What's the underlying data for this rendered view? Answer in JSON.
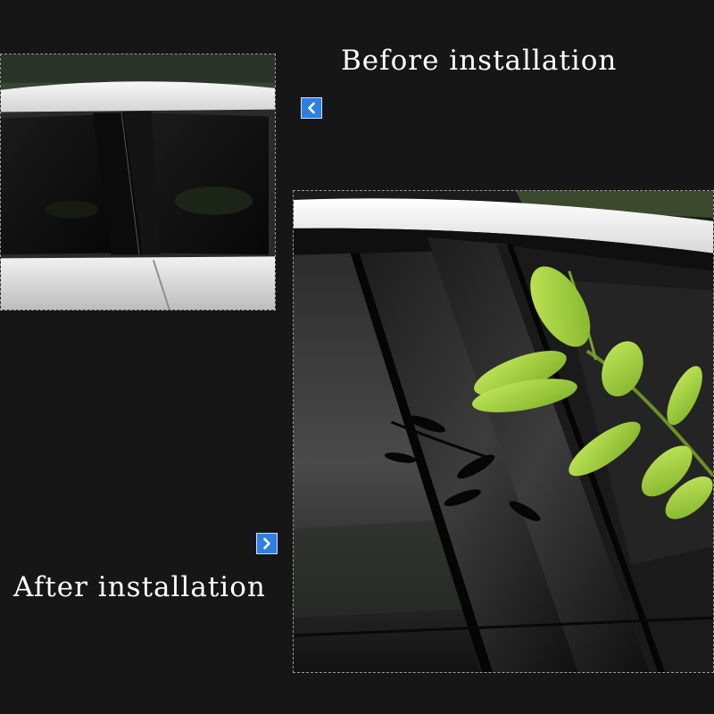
{
  "captions": {
    "before": "Before installation",
    "after": "After installation"
  },
  "icons": {
    "before_arrow": "chevron-left-icon",
    "after_arrow": "chevron-right-icon"
  },
  "colors": {
    "background": "#161616",
    "badge": "#2f7fe0",
    "caption_text": "#ffffff",
    "car_body": "#e9e9e9",
    "window_glass": "#0d0d0d",
    "leaf_green": "#9ccc3a"
  }
}
